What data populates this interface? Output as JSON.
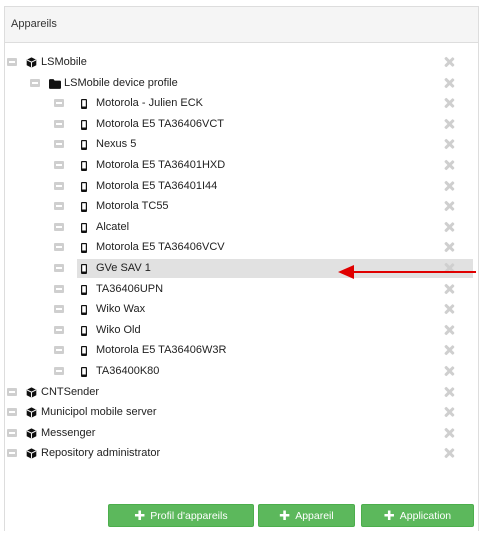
{
  "panel": {
    "title": "Appareils"
  },
  "tree": [
    {
      "label": "LSMobile",
      "type": "package",
      "level": 0
    },
    {
      "label": "LSMobile device profile",
      "type": "folder",
      "level": 1
    },
    {
      "label": "Motorola - Julien ECK",
      "type": "device",
      "level": 2
    },
    {
      "label": "Motorola E5 TA36406VCT",
      "type": "device",
      "level": 2
    },
    {
      "label": "Nexus 5",
      "type": "device",
      "level": 2
    },
    {
      "label": "Motorola E5 TA36401HXD",
      "type": "device",
      "level": 2
    },
    {
      "label": "Motorola E5 TA36401I44",
      "type": "device",
      "level": 2
    },
    {
      "label": "Motorola TC55",
      "type": "device",
      "level": 2
    },
    {
      "label": "Alcatel",
      "type": "device",
      "level": 2
    },
    {
      "label": "Motorola E5 TA36406VCV",
      "type": "device",
      "level": 2
    },
    {
      "label": "GVe SAV 1",
      "type": "device",
      "level": 2,
      "selected": true
    },
    {
      "label": "TA36406UPN",
      "type": "device",
      "level": 2
    },
    {
      "label": "Wiko Wax",
      "type": "device",
      "level": 2
    },
    {
      "label": "Wiko Old",
      "type": "device",
      "level": 2
    },
    {
      "label": "Motorola E5 TA36406W3R",
      "type": "device",
      "level": 2
    },
    {
      "label": "TA36400K80",
      "type": "device",
      "level": 2
    },
    {
      "label": "CNTSender",
      "type": "package",
      "level": 0
    },
    {
      "label": "Municipol mobile server",
      "type": "package",
      "level": 0
    },
    {
      "label": "Messenger",
      "type": "package",
      "level": 0
    },
    {
      "label": "Repository administrator",
      "type": "package",
      "level": 0
    }
  ],
  "buttons": {
    "profile_label": "Profil d'appareils",
    "device_label": "Appareil",
    "application_label": "Application"
  },
  "colors": {
    "button_green": "#5cb85c",
    "selection_bg": "#e1e1e1",
    "arrow_red": "#e00000",
    "muted_icon": "#cfcfcf"
  }
}
